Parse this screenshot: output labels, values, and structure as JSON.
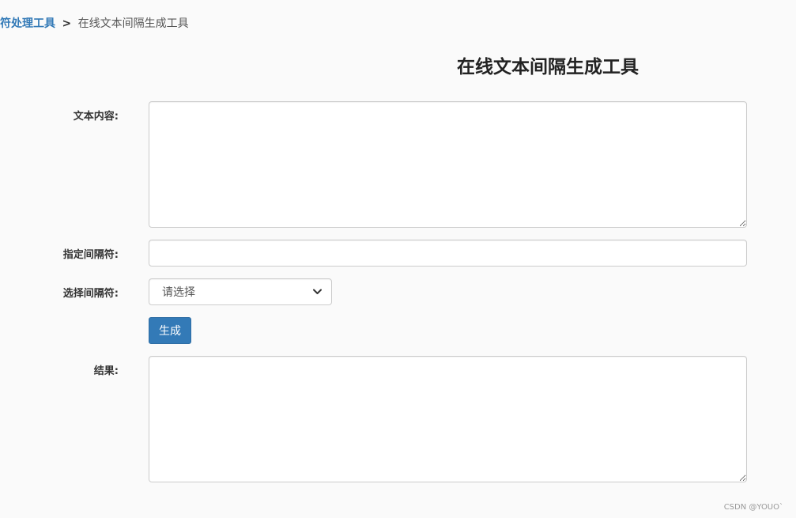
{
  "breadcrumb": {
    "parent_label": "符处理工具",
    "separator": ">",
    "current_label": "在线文本间隔生成工具"
  },
  "page_title": "在线文本间隔生成工具",
  "form": {
    "text_content_label": "文本内容:",
    "text_content_value": "",
    "separator_label": "指定间隔符:",
    "separator_value": "",
    "select_label": "选择间隔符:",
    "select_value": "请选择",
    "generate_button_label": "生成",
    "result_label": "结果:",
    "result_value": ""
  },
  "watermark": "CSDN @YOUO`",
  "colors": {
    "link": "#337ab7",
    "primary_button": "#337ab7",
    "background": "#fafafa"
  },
  "icons": {
    "select_arrow": "chevron-down-icon",
    "resize_handle": "resize-grip-icon"
  }
}
